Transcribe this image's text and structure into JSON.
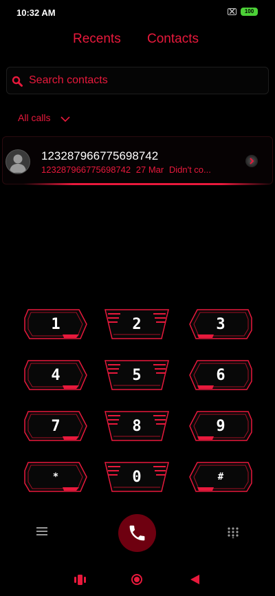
{
  "status_bar": {
    "time": "10:32 AM",
    "battery": "100"
  },
  "tabs": [
    {
      "label": "Recents"
    },
    {
      "label": "Contacts"
    }
  ],
  "search": {
    "placeholder": "Search contacts"
  },
  "filter": {
    "label": "All calls"
  },
  "call_log": [
    {
      "name": "123287966775698742",
      "number": "123287966775698742",
      "date": "27 Mar",
      "status": "Didn't co..."
    }
  ],
  "dialpad": {
    "keys": [
      "1",
      "2",
      "3",
      "4",
      "5",
      "6",
      "7",
      "8",
      "9",
      "*",
      "0",
      "#"
    ]
  },
  "colors": {
    "accent": "#e8193c",
    "call_button": "#6e0010",
    "background": "#000000"
  },
  "icons": {
    "search": "search-icon",
    "menu": "menu-icon",
    "call": "phone-icon",
    "keypad": "keypad-icon",
    "nav_recents": "recents-icon",
    "nav_home": "home-icon",
    "nav_back": "back-icon"
  }
}
